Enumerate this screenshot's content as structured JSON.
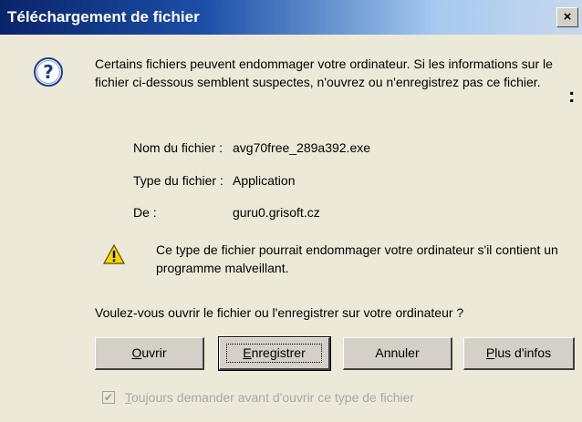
{
  "dialog": {
    "title": "Téléchargement de fichier",
    "close_glyph": "×",
    "icon": "question-icon",
    "side_glyph": ":",
    "message": "Certains fichiers peuvent endommager votre ordinateur. Si les informations sur le fichier ci-dessous semblent suspectes, n'ouvrez ou n'enregistrez pas ce fichier.",
    "file_info": {
      "name_label": "Nom du fichier :",
      "name_value": "avg70free_289a392.exe",
      "type_label": "Type du fichier :",
      "type_value": "Application",
      "from_label": "De :",
      "from_value": "guru0.grisoft.cz"
    },
    "warning": {
      "icon": "warning-icon",
      "text": "Ce type de fichier pourrait endommager votre ordinateur s'il contient un programme malveillant."
    },
    "question": "Voulez-vous ouvrir le fichier ou l'enregistrer sur votre ordinateur ?",
    "buttons": {
      "open_mnemonic": "O",
      "open_rest": "uvrir",
      "save_mnemonic": "E",
      "save_rest": "nregistrer",
      "cancel": "Annuler",
      "info_mnemonic": "P",
      "info_rest": "lus d'infos"
    },
    "checkbox": {
      "checked": true,
      "mark": "✔",
      "label_mnemonic": "T",
      "label_rest": "oujours demander avant d'ouvrir ce type de fichier"
    },
    "colors": {
      "title_start": "#0a246a",
      "title_end": "#c8d8ec",
      "dialog_bg": "#ece9d8",
      "warning_yellow": "#f5d800"
    }
  }
}
